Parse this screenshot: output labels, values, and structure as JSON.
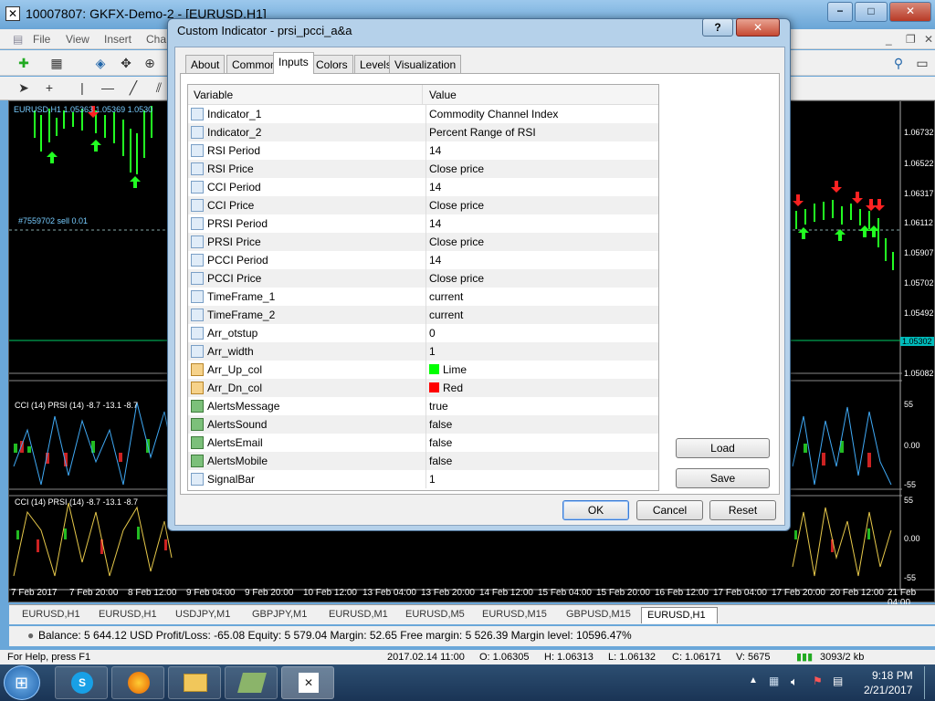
{
  "main_window": {
    "title": "10007807: GKFX-Demo-2 - [EURUSD,H1]",
    "controls": [
      "−",
      "□",
      "✕"
    ]
  },
  "menu": [
    "File",
    "View",
    "Insert",
    "Cha"
  ],
  "chart": {
    "legend_top": "EURUSD,H1 1.05363 1.05369 1.0530",
    "order_label": "#7559702 sell 0.01",
    "indicator1_label": "CCI (14) PRSI (14) -8.7 -13.1 -8.7",
    "indicator2_label": "CCI (14) PRSI (14) -8.7 -13.1 -8.7",
    "prices": [
      "1.06732",
      "1.06522",
      "1.06317",
      "1.06112",
      "1.05907",
      "1.05702",
      "1.05492",
      "1.05302",
      "1.05082"
    ],
    "ind1_levels": [
      "55",
      "0.00",
      "-55"
    ],
    "ind2_levels": [
      "55",
      "0.00",
      "-55"
    ],
    "dates": [
      "7 Feb 2017",
      "7 Feb 20:00",
      "8 Feb 12:00",
      "9 Feb 04:00",
      "9 Feb 20:00",
      "10 Feb 12:00",
      "13 Feb 04:00",
      "13 Feb 20:00",
      "14 Feb 12:00",
      "15 Feb 04:00",
      "15 Feb 20:00",
      "16 Feb 12:00",
      "17 Feb 04:00",
      "17 Feb 20:00",
      "20 Feb 12:00",
      "21 Feb 04:00"
    ]
  },
  "symbol_tabs": [
    "EURUSD,H1",
    "EURUSD,H1",
    "USDJPY,M1",
    "GBPJPY,M1",
    "EURUSD,M1",
    "EURUSD,M5",
    "EURUSD,M15",
    "GBPUSD,M15",
    "EURUSD,H1"
  ],
  "status": {
    "account": "Balance: 5 644.12 USD  Profit/Loss: -65.08  Equity: 5 579.04  Margin: 52.65  Free margin: 5 526.39  Margin level: 10596.47%"
  },
  "helpbar": {
    "help": "For Help, press F1",
    "datetime": "2017.02.14 11:00",
    "open": "O: 1.06305",
    "high": "H: 1.06313",
    "low": "L: 1.06132",
    "close": "C: 1.06171",
    "volume": "V: 5675",
    "traffic": "3093/2 kb"
  },
  "dialog": {
    "title": "Custom Indicator - prsi_pcci_a&a",
    "help_btn": "?",
    "close_btn": "✕",
    "tabs": [
      "About",
      "Common",
      "Inputs",
      "Colors",
      "Levels",
      "Visualization"
    ],
    "active_tab": "Inputs",
    "columns": {
      "variable": "Variable",
      "value": "Value"
    },
    "rows": [
      {
        "name": "Indicator_1",
        "value": "Commodity Channel Index",
        "icon": "123"
      },
      {
        "name": "Indicator_2",
        "value": "Percent Range of RSI",
        "icon": "123"
      },
      {
        "name": "RSI Period",
        "value": "14",
        "icon": "123"
      },
      {
        "name": "RSI Price",
        "value": "Close price",
        "icon": "123"
      },
      {
        "name": "CCI Period",
        "value": "14",
        "icon": "123"
      },
      {
        "name": "CCI Price",
        "value": "Close price",
        "icon": "123"
      },
      {
        "name": "PRSI Period",
        "value": "14",
        "icon": "123"
      },
      {
        "name": "PRSI Price",
        "value": "Close price",
        "icon": "123"
      },
      {
        "name": "PCCI Period",
        "value": "14",
        "icon": "123"
      },
      {
        "name": "PCCI Price",
        "value": "Close price",
        "icon": "123"
      },
      {
        "name": "TimeFrame_1",
        "value": "current",
        "icon": "123"
      },
      {
        "name": "TimeFrame_2",
        "value": "current",
        "icon": "123"
      },
      {
        "name": "Arr_otstup",
        "value": "0",
        "icon": "123"
      },
      {
        "name": "Arr_width",
        "value": "1",
        "icon": "123"
      },
      {
        "name": "Arr_Up_col",
        "value": "Lime",
        "icon": "color",
        "swatch": "#00ff00"
      },
      {
        "name": "Arr_Dn_col",
        "value": "Red",
        "icon": "color",
        "swatch": "#ff0000"
      },
      {
        "name": "AlertsMessage",
        "value": "true",
        "icon": "bool"
      },
      {
        "name": "AlertsSound",
        "value": "false",
        "icon": "bool"
      },
      {
        "name": "AlertsEmail",
        "value": "false",
        "icon": "bool"
      },
      {
        "name": "AlertsMobile",
        "value": "false",
        "icon": "bool"
      },
      {
        "name": "SignalBar",
        "value": "1",
        "icon": "123"
      }
    ],
    "buttons": {
      "load": "Load",
      "save": "Save",
      "ok": "OK",
      "cancel": "Cancel",
      "reset": "Reset"
    }
  },
  "taskbar": {
    "time": "9:18 PM",
    "date": "2/21/2017"
  },
  "colors": {
    "up_arrow": "#00ff00",
    "down_arrow": "#ff0000",
    "chart_bg": "#000000",
    "dialog_frame": "#b5d1ea"
  }
}
